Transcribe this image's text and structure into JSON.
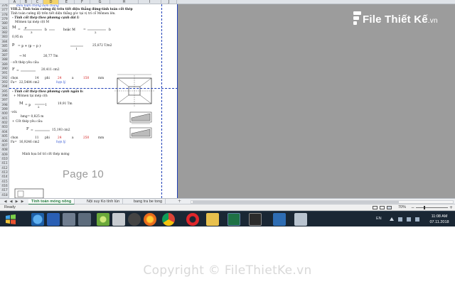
{
  "watermark": {
    "logo_main": "File",
    "logo_rest": "Thiết Kế",
    "logo_suffix": ".vn"
  },
  "columns": [
    "A",
    "B",
    "C",
    "D",
    "E",
    "F",
    "G",
    "H",
    "I",
    "J"
  ],
  "rows": [
    "376",
    "377",
    "378",
    "379",
    "380",
    "381",
    "382",
    "383",
    "384",
    "385",
    "386",
    "387",
    "388",
    "389",
    "390",
    "391",
    "392",
    "393",
    "394",
    "395",
    "396",
    "397",
    "398",
    "399",
    "400",
    "401",
    "402",
    "403",
    "404",
    "405",
    "406",
    "407",
    "408",
    "409",
    "410",
    "411",
    "412",
    "413",
    "414",
    "415",
    "416",
    "417",
    "418"
  ],
  "doc": {
    "l1": "điều kiện chống đâm thủng",
    "l2": "VIII.2. Tính toán cường độ trên tiết diện thẳng đứng-tính toán cốt thép",
    "l3": "Tính toán cường độ trên tiết diện thẳng góc tại vị trí cổ Mômen lớn.",
    "l4": "- Tính cốt thép theo phương cạnh dài I:",
    "l5": "Mômen tại mép cột M",
    "l6": "M",
    "l7": "0,95 m",
    "l8": "p",
    "l9": "25,872  T/m2",
    "l10": "→  M",
    "l11": "26,77  Tm",
    "l12": "- cốt thép yêu cầu:",
    "l13": "F",
    "l14": "20,411  cm2",
    "l15_a": "chọn",
    "l15_b": "14",
    "l15_c": "phi",
    "l15_d": "24",
    "l15_e": "a",
    "l15_f": "150",
    "l15_g": "mm",
    "l16_a": "Fa=",
    "l16_b": "22,5484  cm2",
    "l16_c": "hợp lý",
    "l17": "- Tính cốt thép theo phương cạnh ngắn b:",
    "l18": "+  Mômen tại mép cột:",
    "l19": "M",
    "l20": "19,91  Tm",
    "l21": "-với:",
    "l22": "hmg=    0,825  m",
    "l23": "+  Cốt thép yêu cầu:",
    "l24": "F",
    "l25": "15,193  cm2",
    "l26_a": "chọn",
    "l26_b": "11",
    "l26_c": "phi",
    "l26_d": "24",
    "l26_e": "a",
    "l26_f": "250",
    "l26_g": "mm",
    "l27_a": "Fa=",
    "l27_b": "16,9246  cm2",
    "l27_c": "hợp lý",
    "l28": "Minh họa bố trí cốt thép móng",
    "page_label": "Page 10"
  },
  "tabs": {
    "nav_first": "◀",
    "nav_prev": "◀",
    "nav_next": "▶",
    "nav_last": "▶",
    "sheet1": "Tính toán móng nông",
    "sheet2": "Nội suy Ko tính lún",
    "sheet3": "bang tra be tong",
    "add": "+"
  },
  "status": {
    "ready": "Ready",
    "zoom": "70%",
    "zoom_minus": "−",
    "zoom_plus": "+"
  },
  "taskbar": {
    "lang": "EN",
    "time": "11:08 AM",
    "date": "07.11.2018"
  },
  "copyright": "Copyright © FileThietKe.vn"
}
